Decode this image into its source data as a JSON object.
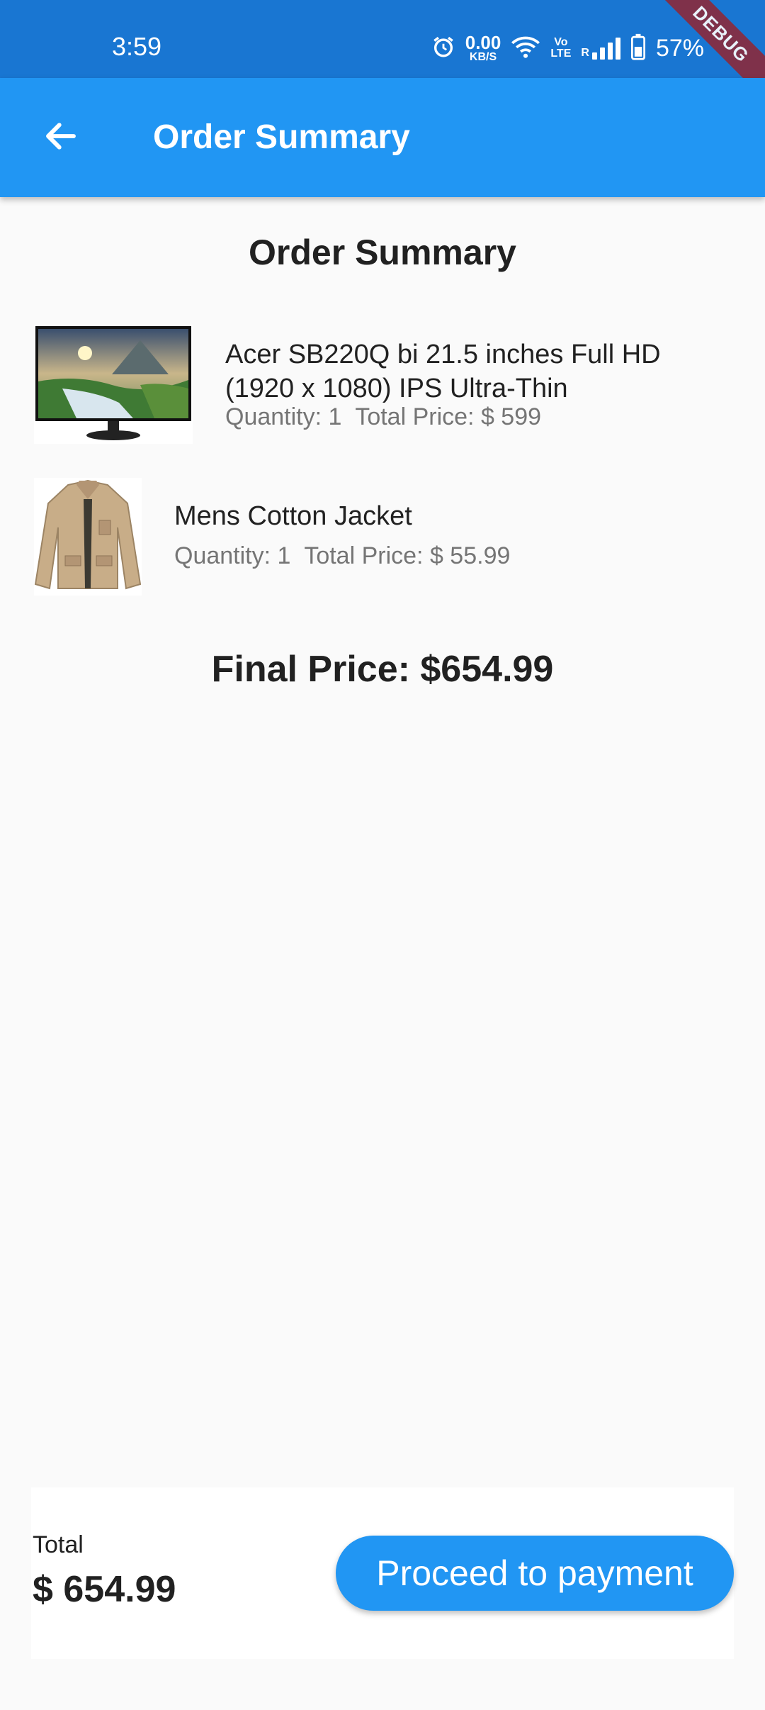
{
  "status_bar": {
    "time": "3:59",
    "net_speed": "0.00",
    "net_unit": "KB/S",
    "volte_top": "Vo",
    "volte_bottom": "LTE",
    "roaming": "R",
    "battery": "57%",
    "icons": [
      "alarm-icon",
      "wifi-icon",
      "signal-icon",
      "battery-icon"
    ],
    "debug_label": "DEBUG"
  },
  "app_bar": {
    "title": "Order Summary",
    "back_icon": "arrow-back-icon",
    "color": "#2196f3"
  },
  "page": {
    "heading": "Order Summary",
    "final_price": "Final Price: $654.99"
  },
  "items": [
    {
      "name_line1": "Acer SB220Q bi 21.5 inches Full HD",
      "name_line2": "(1920 x 1080) IPS Ultra-Thin",
      "quantity": "Quantity: 1",
      "total_price": "Total Price: $ 599",
      "image": "monitor-image"
    },
    {
      "name_line1": "Mens Cotton Jacket",
      "quantity": "Quantity: 1",
      "total_price": "Total Price: $ 55.99",
      "image": "jacket-image"
    }
  ],
  "bottom": {
    "total_label": "Total",
    "total_value": "$ 654.99",
    "button_label": "Proceed to payment"
  }
}
